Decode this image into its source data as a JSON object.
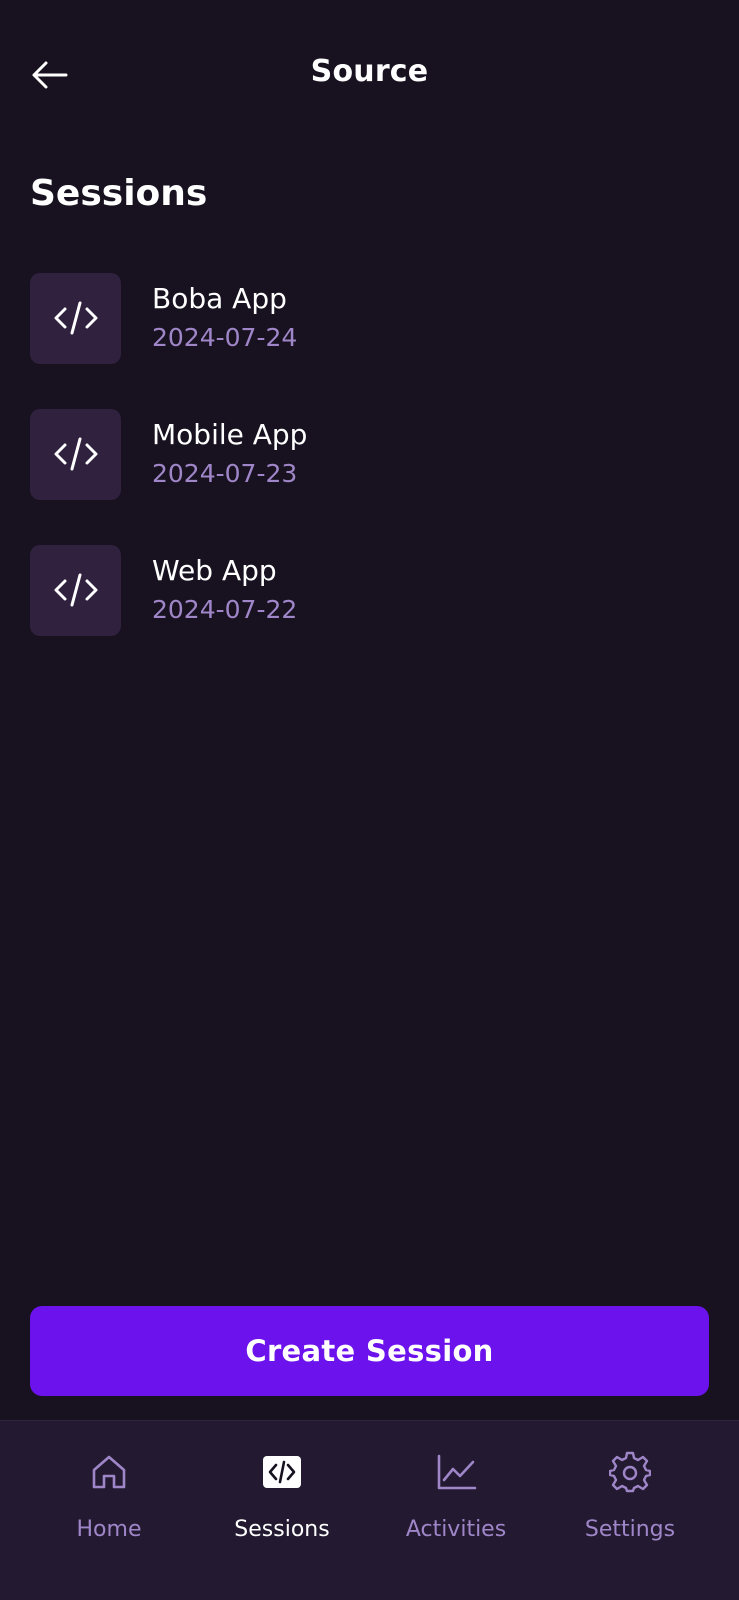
{
  "header": {
    "title": "Source",
    "back_icon": "arrow-left-icon"
  },
  "sessions": {
    "title": "Sessions",
    "items": [
      {
        "name": "Boba App",
        "date": "2024-07-24",
        "icon": "code-icon"
      },
      {
        "name": "Mobile App",
        "date": "2024-07-23",
        "icon": "code-icon"
      },
      {
        "name": "Web App",
        "date": "2024-07-22",
        "icon": "code-icon"
      }
    ]
  },
  "actions": {
    "create_label": "Create Session"
  },
  "nav": {
    "items": [
      {
        "label": "Home",
        "icon": "home-icon",
        "active": false
      },
      {
        "label": "Sessions",
        "icon": "code-icon",
        "active": true
      },
      {
        "label": "Activities",
        "icon": "chart-icon",
        "active": false
      },
      {
        "label": "Settings",
        "icon": "gear-icon",
        "active": false
      }
    ]
  },
  "colors": {
    "background": "#181220",
    "card": "#30213f",
    "accent": "#6c12ec",
    "muted_text": "#9f86c8",
    "nav_background": "#231a31"
  }
}
